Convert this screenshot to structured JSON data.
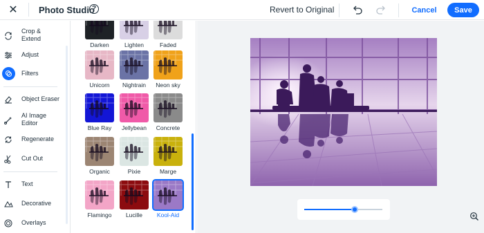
{
  "topbar": {
    "title": "Photo Studio",
    "help": "?",
    "revert_label": "Revert to Original",
    "cancel_label": "Cancel",
    "save_label": "Save"
  },
  "sidebar": {
    "items": [
      {
        "label": "Crop &\nExtend",
        "icon": "crop-rotate-icon"
      },
      {
        "label": "Adjust",
        "icon": "sliders-icon"
      },
      {
        "label": "Filters",
        "icon": "filters-icon",
        "active": true
      },
      {
        "label": "Object Eraser",
        "icon": "eraser-icon"
      },
      {
        "label": "AI Image\nEditor",
        "icon": "ai-brush-icon"
      },
      {
        "label": "Regenerate",
        "icon": "regenerate-icon"
      },
      {
        "label": "Cut Out",
        "icon": "scissors-icon"
      },
      {
        "label": "Text",
        "icon": "text-icon"
      },
      {
        "label": "Decorative",
        "icon": "decorative-icon"
      },
      {
        "label": "Overlays",
        "icon": "overlays-icon"
      }
    ]
  },
  "filters": [
    {
      "name": "Darken",
      "tint": "#1e2226"
    },
    {
      "name": "Lighten",
      "tint": "#d8d0e6"
    },
    {
      "name": "Faded",
      "tint": "#dcdcdc"
    },
    {
      "name": "Unicorn",
      "tint": "#e7b7c6"
    },
    {
      "name": "Nightrain",
      "tint": "#6b73a6"
    },
    {
      "name": "Neon sky",
      "tint": "#f0a21a"
    },
    {
      "name": "Blue Ray",
      "tint": "#1316d6"
    },
    {
      "name": "Jellybean",
      "tint": "#f05aa8"
    },
    {
      "name": "Concrete",
      "tint": "#8a8a8a"
    },
    {
      "name": "Organic",
      "tint": "#9c8573"
    },
    {
      "name": "Pixie",
      "tint": "#dbe6e3"
    },
    {
      "name": "Marge",
      "tint": "#c9b10c"
    },
    {
      "name": "Flamingo",
      "tint": "#f3a5c7"
    },
    {
      "name": "Lucille",
      "tint": "#8c0b0f"
    },
    {
      "name": "Kool-Aid",
      "tint": "#9b79c6",
      "selected": true
    }
  ],
  "slider": {
    "value": 0.65
  },
  "colors": {
    "accent": "#116dff",
    "photo_tint": "#c4a4d9"
  }
}
